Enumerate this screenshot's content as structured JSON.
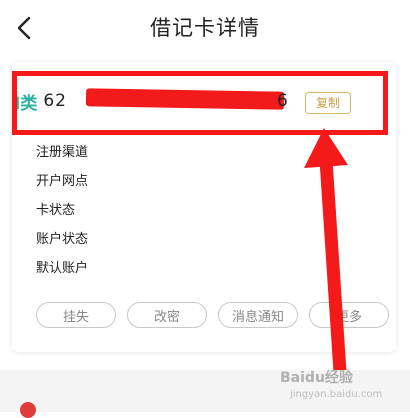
{
  "header": {
    "title": "借记卡详情"
  },
  "card": {
    "type_label": "I类",
    "number_prefix": "62",
    "number_suffix": "6",
    "copy_label": "复制"
  },
  "info_rows": [
    {
      "label": "注册渠道"
    },
    {
      "label": "开户网点"
    },
    {
      "label": "卡状态"
    },
    {
      "label": "账户状态"
    },
    {
      "label": "默认账户"
    }
  ],
  "actions": [
    {
      "label": "挂失"
    },
    {
      "label": "改密"
    },
    {
      "label": "消息通知"
    },
    {
      "label": "更多"
    }
  ],
  "watermark": {
    "text": "Baidu经验",
    "url": "jingyan.baidu.com"
  },
  "colors": {
    "accent_teal": "#2bb0a0",
    "annotation_red": "#f41a1a",
    "copy_gold": "#c9a04a"
  }
}
